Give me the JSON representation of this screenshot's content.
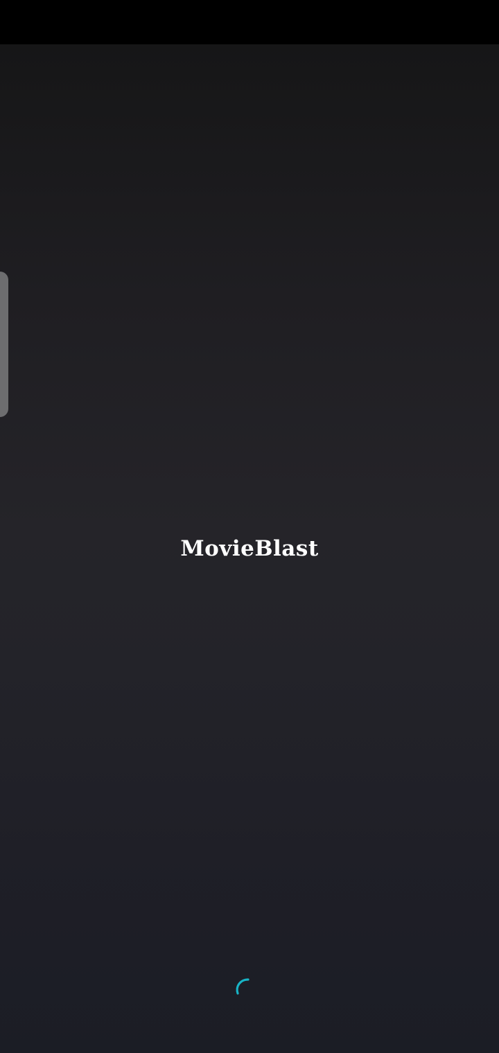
{
  "app": {
    "name": "MovieBlast"
  },
  "theme": {
    "background_top": "#161617",
    "background_mid": "#252429",
    "background_bottom": "#1b1d25",
    "status_bar": "#000000",
    "logo_text": "#ffffff",
    "spinner_accent": "#18b4c6",
    "edge_handle": "#6d6d6f"
  },
  "loading": {
    "icon": "loading-spinner-icon"
  }
}
